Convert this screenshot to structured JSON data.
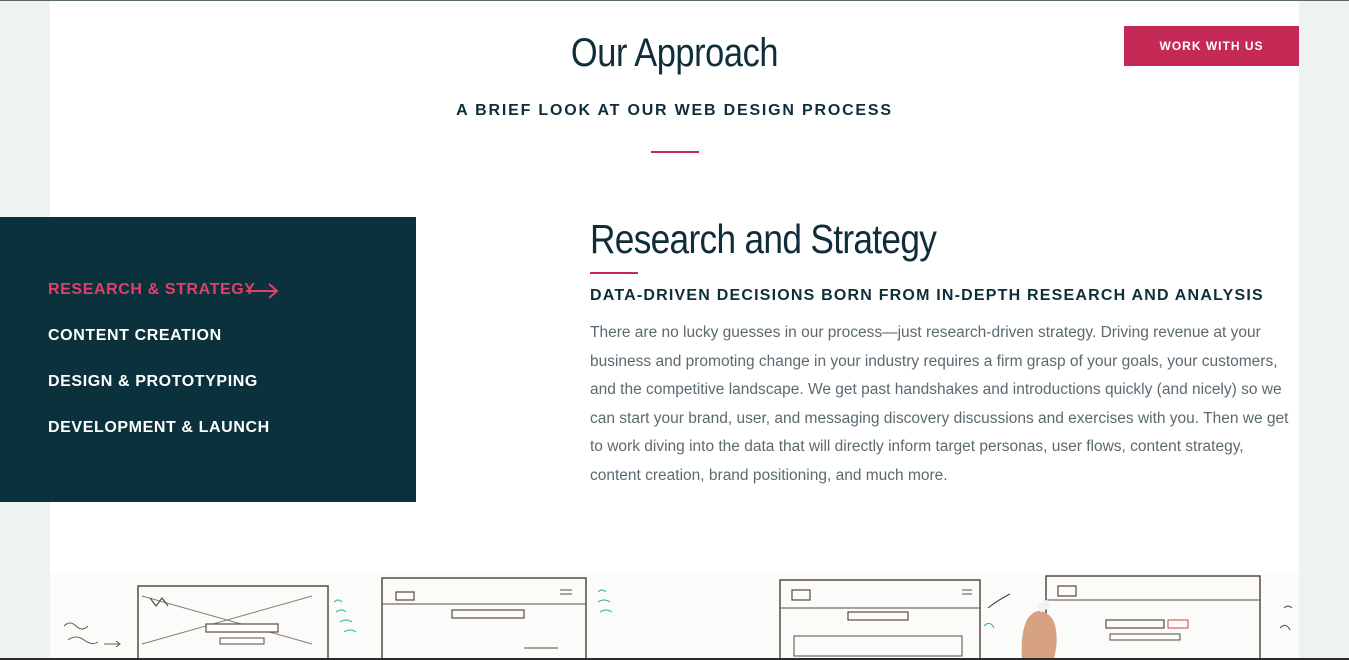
{
  "cta": {
    "label": "WORK WITH US"
  },
  "header": {
    "title": "Our Approach",
    "subtitle": "A BRIEF LOOK AT OUR WEB DESIGN PROCESS"
  },
  "sidebar": {
    "items": [
      {
        "label": "RESEARCH & STRATEGY",
        "active": true
      },
      {
        "label": "CONTENT CREATION",
        "active": false
      },
      {
        "label": "DESIGN & PROTOTYPING",
        "active": false
      },
      {
        "label": "DEVELOPMENT & LAUNCH",
        "active": false
      }
    ]
  },
  "content": {
    "title": "Research and Strategy",
    "subtitle": "DATA-DRIVEN DECISIONS BORN FROM IN-DEPTH RESEARCH AND ANALYSIS",
    "body": "There are no lucky guesses in our process—just research-driven strategy. Driving revenue at your business and promoting change in your industry requires a firm grasp of your goals, your customers, and the competitive landscape. We get past handshakes and introductions quickly (and nicely) so we can start your brand, user, and messaging discovery discussions and exercises with you. Then we get to work diving into the data that will directly inform target personas, user flows, content strategy, content creation, brand positioning, and much more."
  },
  "colors": {
    "accent": "#c42a55",
    "navy": "#0b313c",
    "text": "#0f2e3a",
    "body_text": "#5b6a70"
  },
  "icons": {
    "active_indicator": "arrow-right-icon",
    "photo": "wireframe-sketch-image"
  }
}
